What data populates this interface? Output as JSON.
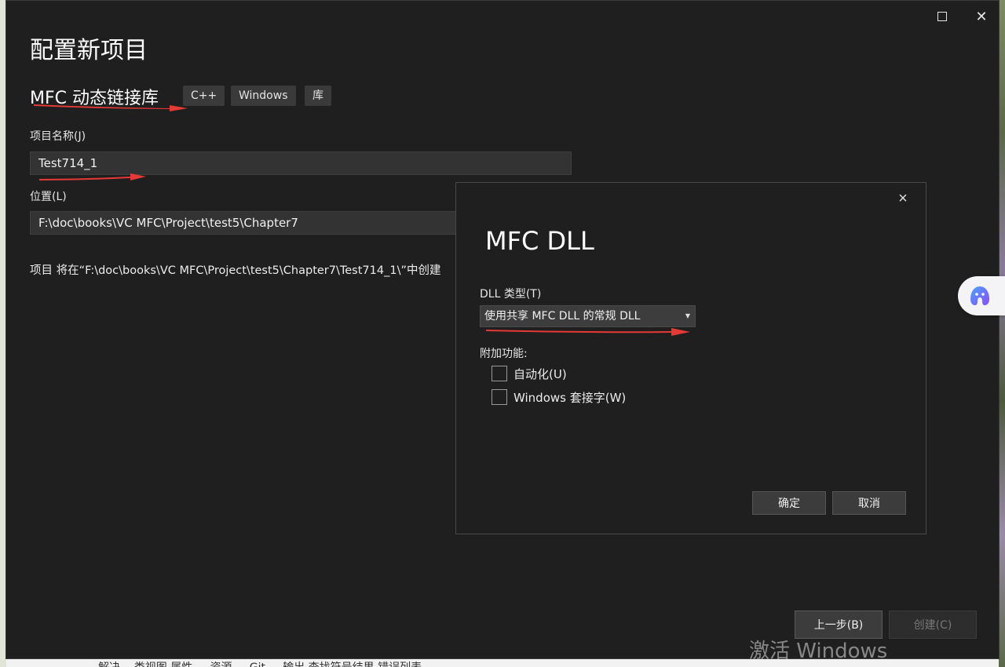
{
  "window": {
    "title": "配置新项目",
    "template_name": "MFC 动态链接库",
    "tags": [
      "C++",
      "Windows",
      "库"
    ],
    "project_name_label": "项目名称(J)",
    "project_name_value": "Test714_1",
    "location_label": "位置(L)",
    "location_value": "F:\\doc\\books\\VC MFC\\Project\\test5\\Chapter7",
    "path_note": "项目 将在“F:\\doc\\books\\VC MFC\\Project\\test5\\Chapter7\\Test714_1\\”中创建",
    "back_button": "上一步(B)",
    "create_button": "创建(C)",
    "watermark": "激活 Windows"
  },
  "modal": {
    "title": "MFC DLL",
    "dll_type_label": "DLL 类型(T)",
    "dll_type_value": "使用共享 MFC DLL 的常规 DLL",
    "features_label": "附加功能:",
    "options": [
      {
        "label": "自动化(U)",
        "checked": false
      },
      {
        "label": "Windows 套接字(W)",
        "checked": false
      }
    ],
    "ok_button": "确定",
    "cancel_button": "取消"
  },
  "taskbar": {
    "text": "解决...  类视图  属性  ...  资源  ...  Git ...  输出  查找符号结果  错误列表"
  },
  "colors": {
    "window_bg": "#1f1f1f",
    "annotation": "#e53935",
    "assistant_accent": "#6a5cf0"
  }
}
